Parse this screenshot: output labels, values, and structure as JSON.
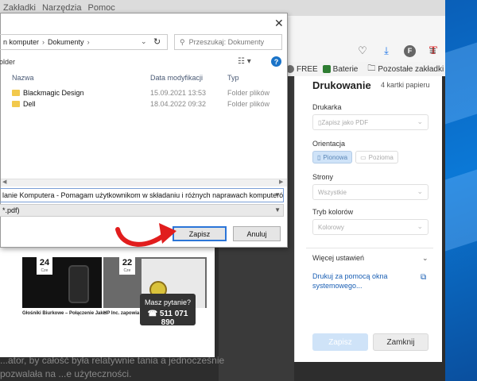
{
  "menubar": {
    "items": [
      "Zakładki",
      "Narzędzia",
      "Pomoc"
    ]
  },
  "bookmarks": [
    {
      "label": "FREE",
      "color": "#6f6f6f"
    },
    {
      "label": "Baterie",
      "color": "#2e7d32"
    },
    {
      "label": "Pozostałe zakładki",
      "color": "#555555"
    }
  ],
  "toolbar": {
    "profile_letter": "F",
    "extension_letter": "T"
  },
  "dialog": {
    "breadcrumb": [
      "n komputer",
      "Dokumenty"
    ],
    "search_placeholder": "Przeszukaj: Dokumenty",
    "folder_button": "older",
    "columns": {
      "name": "Nazwa",
      "date": "Data modyfikacji",
      "type": "Typ"
    },
    "files": [
      {
        "name": "Blackmagic Design",
        "date": "15.09.2021 13:53",
        "type": "Folder plików"
      },
      {
        "name": "Dell",
        "date": "18.04.2022 09:32",
        "type": "Folder plików"
      }
    ],
    "filename": "lanie Komputera - Pomagam użytkownikom w składaniu i różnych naprawach komputerów.pdf",
    "filetype": "*.pdf)",
    "save_label": "Zapisz",
    "cancel_label": "Anuluj"
  },
  "print_panel": {
    "title": "Drukowanie",
    "pages_count": "4 kartki papieru",
    "printer_label": "Drukarka",
    "printer_value": "Zapisz jako PDF",
    "orientation_label": "Orientacja",
    "orientation_portrait": "Pionowa",
    "orientation_landscape": "Pozioma",
    "pages_label": "Strony",
    "pages_value": "Wszystkie",
    "color_label": "Tryb kolorów",
    "color_value": "Kolorowy",
    "more_settings": "Więcej ustawień",
    "system_dialog": "Drukuj za pomocą okna systemowego...",
    "print_button": "Zapisz",
    "cancel_button": "Zamknij"
  },
  "preview": {
    "card1_day": "24",
    "card1_month": "Cze",
    "card1_title": "Głośniki Biurkowe – Połączenie Jakc",
    "card2_day": "22",
    "card2_month": "Cze",
    "card2_title": "HP Inc. zapowia",
    "ask_question": "Masz pytanie?",
    "ask_phone": "511 071 890"
  },
  "background_text": "...ator, by całość była relatywnie tania a jednocześnie pozwalała na ...e użyteczności."
}
